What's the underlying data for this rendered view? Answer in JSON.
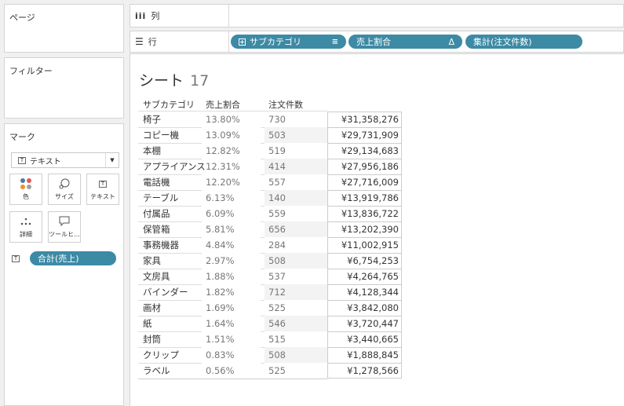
{
  "pages_panel": {
    "title": "ページ"
  },
  "filters_panel": {
    "title": "フィルター"
  },
  "marks_panel": {
    "title": "マーク",
    "mark_type": "テキスト",
    "buttons": [
      {
        "label": "色",
        "icon": "color-dots-icon"
      },
      {
        "label": "サイズ",
        "icon": "size-icon"
      },
      {
        "label": "テキスト",
        "icon": "text-icon"
      },
      {
        "label": "詳細",
        "icon": "detail-dots-icon"
      },
      {
        "label": "ツールヒ...",
        "icon": "tooltip-icon"
      }
    ],
    "text_field": "合計(売上)"
  },
  "columns_shelf": {
    "label": "列"
  },
  "rows_shelf": {
    "label": "行",
    "pills": [
      "サブカテゴリ",
      "売上割合",
      "集計(注文件数)"
    ],
    "delta_symbol": "Δ"
  },
  "sheet": {
    "title_main": "シート",
    "title_num": "17",
    "headers": [
      "サブカテゴリ",
      "売上割合",
      "注文件数"
    ],
    "rows": [
      {
        "cat": "椅子",
        "pct": "13.80%",
        "count": "730",
        "sales": "¥31,358,276"
      },
      {
        "cat": "コピー機",
        "pct": "13.09%",
        "count": "503",
        "sales": "¥29,731,909"
      },
      {
        "cat": "本棚",
        "pct": "12.82%",
        "count": "519",
        "sales": "¥29,134,683"
      },
      {
        "cat": "アプライアンス",
        "pct": "12.31%",
        "count": "414",
        "sales": "¥27,956,186"
      },
      {
        "cat": "電話機",
        "pct": "12.20%",
        "count": "557",
        "sales": "¥27,716,009"
      },
      {
        "cat": "テーブル",
        "pct": "6.13%",
        "count": "140",
        "sales": "¥13,919,786"
      },
      {
        "cat": "付属品",
        "pct": "6.09%",
        "count": "559",
        "sales": "¥13,836,722"
      },
      {
        "cat": "保管箱",
        "pct": "5.81%",
        "count": "656",
        "sales": "¥13,202,390"
      },
      {
        "cat": "事務機器",
        "pct": "4.84%",
        "count": "284",
        "sales": "¥11,002,915"
      },
      {
        "cat": "家具",
        "pct": "2.97%",
        "count": "508",
        "sales": "¥6,754,253"
      },
      {
        "cat": "文房具",
        "pct": "1.88%",
        "count": "537",
        "sales": "¥4,264,765"
      },
      {
        "cat": "バインダー",
        "pct": "1.82%",
        "count": "712",
        "sales": "¥4,128,344"
      },
      {
        "cat": "画材",
        "pct": "1.69%",
        "count": "525",
        "sales": "¥3,842,080"
      },
      {
        "cat": "紙",
        "pct": "1.64%",
        "count": "546",
        "sales": "¥3,720,447"
      },
      {
        "cat": "封筒",
        "pct": "1.51%",
        "count": "515",
        "sales": "¥3,440,665"
      },
      {
        "cat": "クリップ",
        "pct": "0.83%",
        "count": "508",
        "sales": "¥1,888,845"
      },
      {
        "cat": "ラベル",
        "pct": "0.56%",
        "count": "525",
        "sales": "¥1,278,566"
      }
    ]
  },
  "colors": {
    "pill": "#3d8aa5",
    "row_band": "#f3f3f3"
  }
}
